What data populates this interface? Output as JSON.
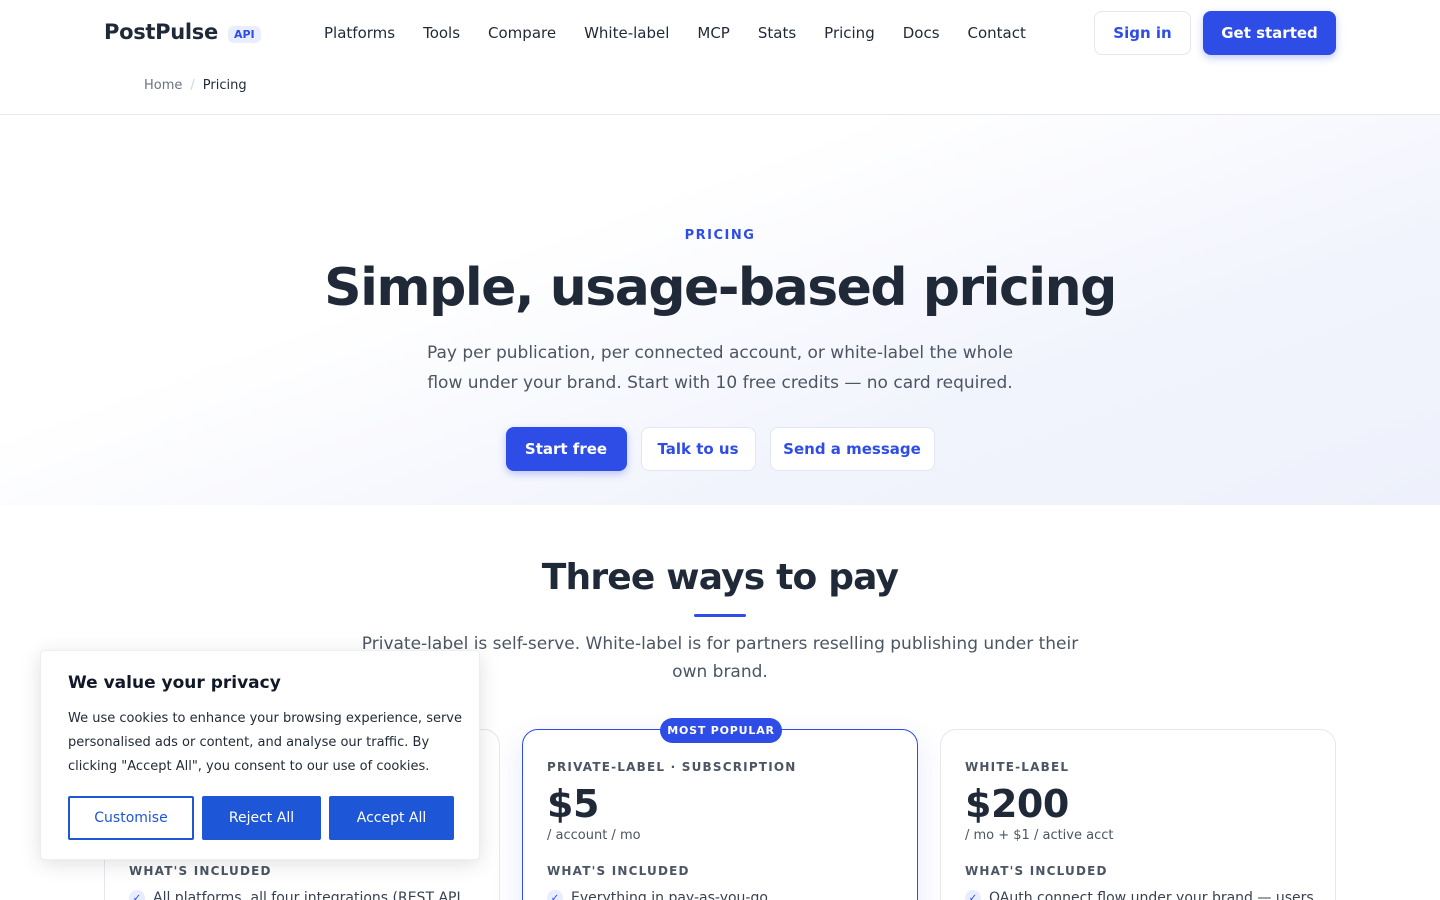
{
  "brand": {
    "name": "PostPulse",
    "badge": "API"
  },
  "nav": {
    "items": [
      "Platforms",
      "Tools",
      "Compare",
      "White-label",
      "MCP",
      "Stats",
      "Pricing",
      "Docs",
      "Contact"
    ],
    "sign_in": "Sign in",
    "get_started": "Get started"
  },
  "breadcrumb": {
    "home": "Home",
    "separator": "/",
    "current": "Pricing"
  },
  "hero": {
    "eyebrow": "PRICING",
    "title": "Simple, usage-based pricing",
    "subtitle": "Pay per publication, per connected account, or white-label the whole flow under your brand. Start with 10 free credits — no card required.",
    "cta_primary": "Start free",
    "cta_talk": "Talk to us",
    "cta_message": "Send a message"
  },
  "section": {
    "title": "Three ways to pay",
    "subtitle": "Private-label is self-serve. White-label is for partners reselling publishing under their own brand."
  },
  "plans": [
    {
      "label": "",
      "price": "",
      "unit": "",
      "included_heading": "WHAT'S INCLUDED",
      "first_item": "All platforms, all four integrations (REST API,"
    },
    {
      "badge": "MOST POPULAR",
      "label": "PRIVATE-LABEL · SUBSCRIPTION",
      "price": "$5",
      "unit": "/ account / mo",
      "included_heading": "WHAT'S INCLUDED",
      "first_item": "Everything in pay-as-you-go"
    },
    {
      "label": "WHITE-LABEL",
      "price": "$200",
      "unit": "/ mo + $1 / active acct",
      "included_heading": "WHAT'S INCLUDED",
      "first_item": "OAuth connect flow under your brand — users"
    }
  ],
  "cookie": {
    "title": "We value your privacy",
    "text": "We use cookies to enhance your browsing experience, serve personalised ads or content, and analyse our traffic. By clicking \"Accept All\", you consent to our use of cookies.",
    "customise": "Customise",
    "reject": "Reject All",
    "accept": "Accept All"
  },
  "colors": {
    "accent": "#2e4de6",
    "cookie_accent": "#1e56d8",
    "text": "#1f2937"
  },
  "icons": {
    "check": "check-icon"
  }
}
